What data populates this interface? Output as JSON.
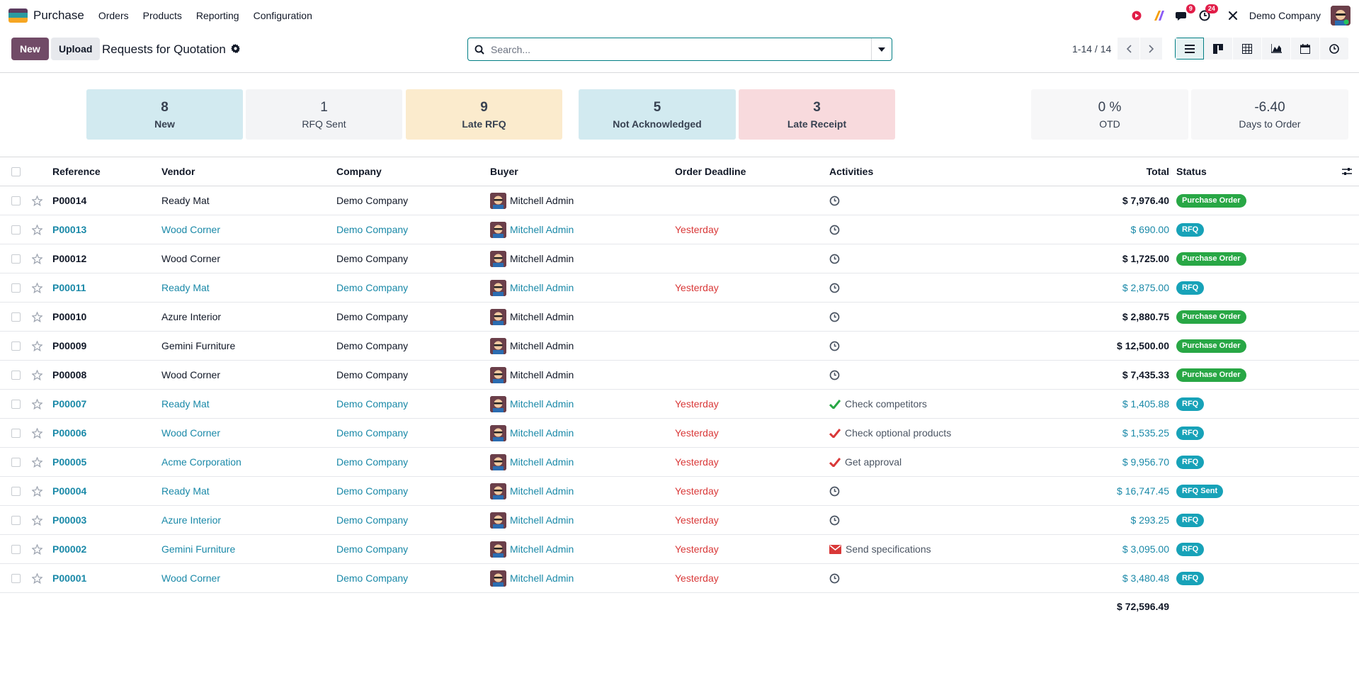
{
  "navbar": {
    "app_name": "Purchase",
    "menu": [
      "Orders",
      "Products",
      "Reporting",
      "Configuration"
    ],
    "messages_count": "9",
    "activities_count": "24",
    "company": "Demo Company",
    "colors": {
      "logo_top": "#5c3c60",
      "logo_mid": "#2b9aa0",
      "logo_bot": "#f6a623"
    }
  },
  "control": {
    "new_label": "New",
    "upload_label": "Upload",
    "title": "Requests for Quotation",
    "search_placeholder": "Search...",
    "pager": "1-14 / 14"
  },
  "dashboard": {
    "tiles": [
      {
        "value": "8",
        "label": "New",
        "bg": "#d2eaf0"
      },
      {
        "value": "1",
        "label": "RFQ Sent",
        "bg": "#f3f4f6"
      },
      {
        "value": "9",
        "label": "Late RFQ",
        "bg": "#fbebcd"
      },
      {
        "value": "5",
        "label": "Not Acknowledged",
        "bg": "#d2eaf0"
      },
      {
        "value": "3",
        "label": "Late Receipt",
        "bg": "#f8dadd"
      }
    ],
    "kpis": [
      {
        "value": "0 %",
        "label": "OTD"
      },
      {
        "value": "-6.40",
        "label": "Days to Order"
      }
    ]
  },
  "table": {
    "headers": {
      "reference": "Reference",
      "vendor": "Vendor",
      "company": "Company",
      "buyer": "Buyer",
      "deadline": "Order Deadline",
      "activities": "Activities",
      "total": "Total",
      "status": "Status"
    },
    "rows": [
      {
        "ref": "P00014",
        "vendor": "Ready Mat",
        "company": "Demo Company",
        "buyer": "Mitchell Admin",
        "deadline": "",
        "activity": "",
        "activity_icon": "clock-icon",
        "total": "$ 7,976.40",
        "status": "Purchase Order",
        "style": "bold"
      },
      {
        "ref": "P00013",
        "vendor": "Wood Corner",
        "company": "Demo Company",
        "buyer": "Mitchell Admin",
        "deadline": "Yesterday",
        "activity": "",
        "activity_icon": "clock-icon",
        "total": "$ 690.00",
        "status": "RFQ",
        "style": "blue"
      },
      {
        "ref": "P00012",
        "vendor": "Wood Corner",
        "company": "Demo Company",
        "buyer": "Mitchell Admin",
        "deadline": "",
        "activity": "",
        "activity_icon": "clock-icon",
        "total": "$ 1,725.00",
        "status": "Purchase Order",
        "style": "bold"
      },
      {
        "ref": "P00011",
        "vendor": "Ready Mat",
        "company": "Demo Company",
        "buyer": "Mitchell Admin",
        "deadline": "Yesterday",
        "activity": "",
        "activity_icon": "clock-icon",
        "total": "$ 2,875.00",
        "status": "RFQ",
        "style": "blue"
      },
      {
        "ref": "P00010",
        "vendor": "Azure Interior",
        "company": "Demo Company",
        "buyer": "Mitchell Admin",
        "deadline": "",
        "activity": "",
        "activity_icon": "clock-icon",
        "total": "$ 2,880.75",
        "status": "Purchase Order",
        "style": "bold"
      },
      {
        "ref": "P00009",
        "vendor": "Gemini Furniture",
        "company": "Demo Company",
        "buyer": "Mitchell Admin",
        "deadline": "",
        "activity": "",
        "activity_icon": "clock-icon",
        "total": "$ 12,500.00",
        "status": "Purchase Order",
        "style": "bold"
      },
      {
        "ref": "P00008",
        "vendor": "Wood Corner",
        "company": "Demo Company",
        "buyer": "Mitchell Admin",
        "deadline": "",
        "activity": "",
        "activity_icon": "clock-icon",
        "total": "$ 7,435.33",
        "status": "Purchase Order",
        "style": "bold"
      },
      {
        "ref": "P00007",
        "vendor": "Ready Mat",
        "company": "Demo Company",
        "buyer": "Mitchell Admin",
        "deadline": "Yesterday",
        "activity": "Check competitors",
        "activity_icon": "check-green-icon",
        "total": "$ 1,405.88",
        "status": "RFQ",
        "style": "blue"
      },
      {
        "ref": "P00006",
        "vendor": "Wood Corner",
        "company": "Demo Company",
        "buyer": "Mitchell Admin",
        "deadline": "Yesterday",
        "activity": "Check optional products",
        "activity_icon": "check-red-icon",
        "total": "$ 1,535.25",
        "status": "RFQ",
        "style": "blue"
      },
      {
        "ref": "P00005",
        "vendor": "Acme Corporation",
        "company": "Demo Company",
        "buyer": "Mitchell Admin",
        "deadline": "Yesterday",
        "activity": "Get approval",
        "activity_icon": "check-red-icon",
        "total": "$ 9,956.70",
        "status": "RFQ",
        "style": "blue"
      },
      {
        "ref": "P00004",
        "vendor": "Ready Mat",
        "company": "Demo Company",
        "buyer": "Mitchell Admin",
        "deadline": "Yesterday",
        "activity": "",
        "activity_icon": "clock-icon",
        "total": "$ 16,747.45",
        "status": "RFQ Sent",
        "style": "blue"
      },
      {
        "ref": "P00003",
        "vendor": "Azure Interior",
        "company": "Demo Company",
        "buyer": "Mitchell Admin",
        "deadline": "Yesterday",
        "activity": "",
        "activity_icon": "clock-icon",
        "total": "$ 293.25",
        "status": "RFQ",
        "style": "blue"
      },
      {
        "ref": "P00002",
        "vendor": "Gemini Furniture",
        "company": "Demo Company",
        "buyer": "Mitchell Admin",
        "deadline": "Yesterday",
        "activity": "Send specifications",
        "activity_icon": "envelope-icon",
        "total": "$ 3,095.00",
        "status": "RFQ",
        "style": "blue"
      },
      {
        "ref": "P00001",
        "vendor": "Wood Corner",
        "company": "Demo Company",
        "buyer": "Mitchell Admin",
        "deadline": "Yesterday",
        "activity": "",
        "activity_icon": "clock-icon",
        "total": "$ 3,480.48",
        "status": "RFQ",
        "style": "blue"
      }
    ],
    "grand_total": "$ 72,596.49"
  }
}
